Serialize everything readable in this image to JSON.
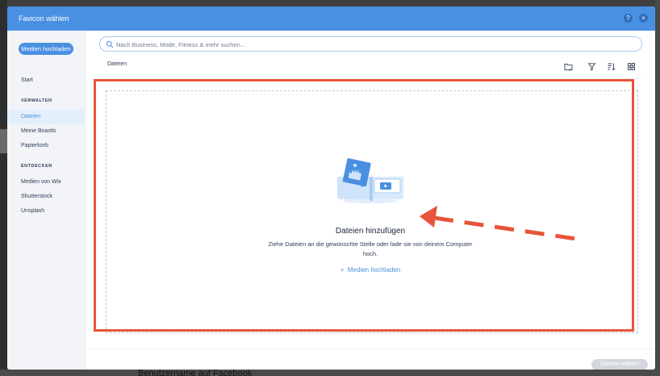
{
  "dialog": {
    "title": "Favicon wählen",
    "help_label": "?",
    "close_label": "×"
  },
  "sidebar": {
    "upload_button": "Medien hochladen",
    "start": "Start",
    "manage_heading": "VERWALTEN",
    "manage_items": [
      "Dateien",
      "Meine Boards",
      "Papierkorb"
    ],
    "discover_heading": "ENTDECKEN",
    "discover_items": [
      "Medien von Wix",
      "Shutterstock",
      "Unsplash"
    ],
    "active_item": "Dateien"
  },
  "search": {
    "placeholder": "Nach Business, Mode, Fitness & mehr suchen..."
  },
  "breadcrumb": "Dateien",
  "toolbar": {
    "icons": [
      "new-folder-icon",
      "filter-icon",
      "sort-icon",
      "grid-view-icon"
    ]
  },
  "dropzone": {
    "title": "Dateien hinzufügen",
    "text": "Ziehe Dateien an die gewünschte Stelle oder lade sie von deinem Computer hoch.",
    "link_icon": "+",
    "link_label": "Medien hochladen"
  },
  "footer": {
    "confirm_button": "Dateien wählen"
  },
  "background": {
    "caption": "Benutzername auf Facebook"
  },
  "colors": {
    "accent": "#4a90e2",
    "annotation": "#e8543a"
  }
}
